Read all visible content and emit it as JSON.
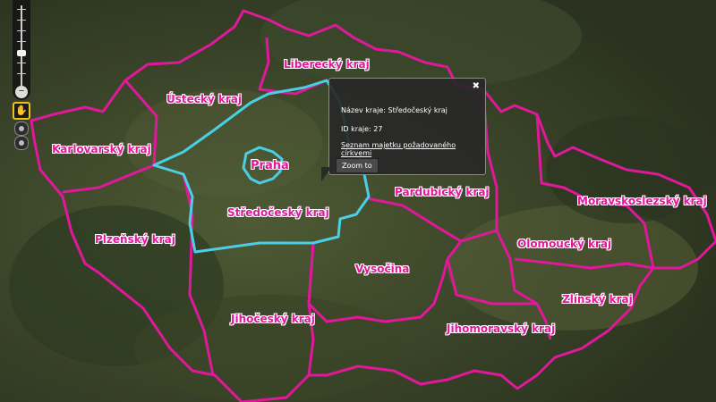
{
  "map": {
    "colors": {
      "border": "#e0189a",
      "selected_border": "#49d0e6",
      "label": "#e0189a",
      "terrain_dark": "#2f3a24",
      "terrain_mid": "#46522f"
    },
    "regions": [
      {
        "id": "liberecky",
        "label": "Liberecký kraj"
      },
      {
        "id": "ustecky",
        "label": "Ústecký kraj"
      },
      {
        "id": "karlovarsky",
        "label": "Karlovarský kraj"
      },
      {
        "id": "praha",
        "label": "Praha"
      },
      {
        "id": "stredocesky",
        "label": "Středočeský kraj"
      },
      {
        "id": "pardubicky",
        "label": "Pardubický kraj"
      },
      {
        "id": "moravskoslezsky",
        "label": "Moravskoslezský kraj"
      },
      {
        "id": "plzensky",
        "label": "Plzeňský kraj"
      },
      {
        "id": "olomoucky",
        "label": "Olomoucký kraj"
      },
      {
        "id": "vysocina",
        "label": "Vysočina"
      },
      {
        "id": "zlinsky",
        "label": "Zlínský kraj"
      },
      {
        "id": "jihocesky",
        "label": "Jihočeský kraj"
      },
      {
        "id": "jihomoravsky",
        "label": "Jihomoravský kraj"
      }
    ]
  },
  "popup": {
    "close_symbol": "✖",
    "name_line": "Název kraje: Středočeský kraj",
    "id_line": "ID kraje: 27",
    "link_text": "Seznam majetku požadovaného církvemi",
    "zoom_button": "Zoom to"
  },
  "controls": {
    "zoom_out_symbol": "−",
    "pan_symbol": "✋"
  }
}
